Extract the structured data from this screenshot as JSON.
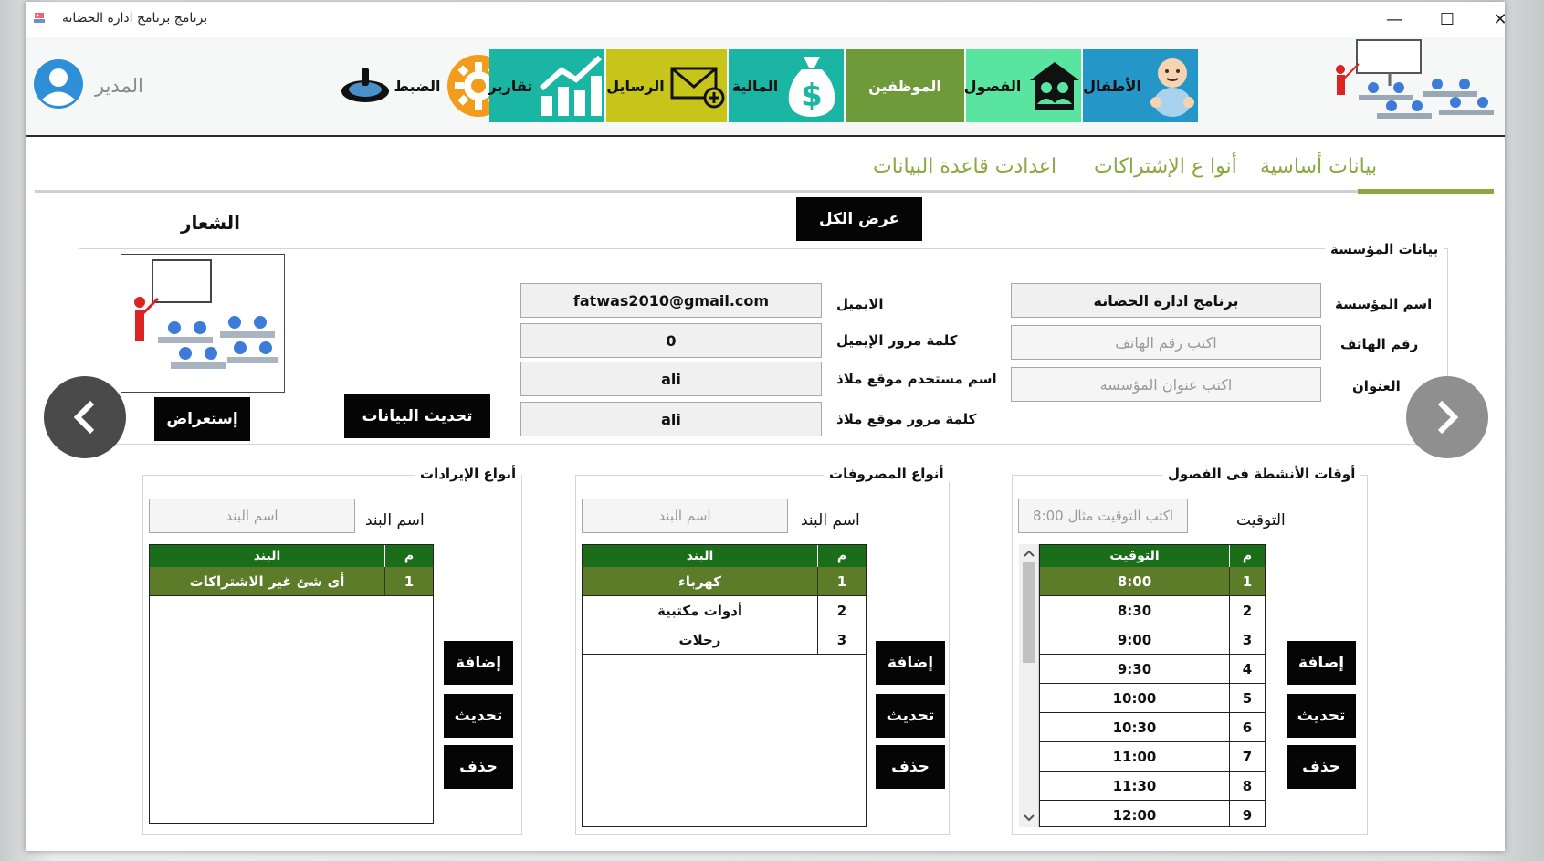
{
  "window": {
    "title": "برنامج  برنامج ادارة الحضانة",
    "controls": {
      "minimize": "—",
      "maximize": "☐",
      "close": "✕"
    }
  },
  "toolbar": {
    "user": "المدير",
    "settings": "الضبط",
    "reports": "تقارير",
    "messages": "الرسايل",
    "finance": "المالية",
    "employees": "الموظفين",
    "classes": "الفصول",
    "children": "الأطفال",
    "colors": {
      "settings": "#f39c1c",
      "reports": "#1ab5a3",
      "messages": "#c8c51a",
      "finance": "#1ab5a3",
      "employees": "#6f9a3a",
      "classes": "#59e59f",
      "children": "#2596c8"
    }
  },
  "tabs": {
    "basic_data": "بيانات أساسية",
    "subscription_types": "أنوا ع الإشتراكات",
    "db_settings": "اعدادت قاعدة البيانات"
  },
  "main": {
    "show_all": "عرض الكل",
    "logo_title": "الشعار",
    "browse": "إستعراض",
    "update_data": "تحديث البيانات"
  },
  "institution": {
    "group_title": "بيانات المؤسسة",
    "name_label": "اسم المؤسسة",
    "name_value": "برنامج ادارة الحضانة",
    "phone_label": "رقم الهاتف",
    "phone_placeholder": "اكتب رقم الهاتف",
    "address_label": "العنوان",
    "address_placeholder": "اكتب عنوان المؤسسة",
    "email_label": "الايميل",
    "email_value": "fatwas2010@gmail.com",
    "email_pass_label": "كلمة مرور الإيميل",
    "email_pass_value": "0",
    "malath_user_label": "اسم مستخدم موقع ملاذ",
    "malath_user_value": "ali",
    "malath_pass_label": "كلمة مرور موقع ملاذ",
    "malath_pass_value": "ali"
  },
  "activity_times": {
    "group_title": "أوقات الأنشطة فى الفصول",
    "time_label": "التوقيت",
    "time_placeholder": "اكتب التوقيت مثال 8:00",
    "col_num": "م",
    "col_time": "التوقيت",
    "rows": [
      {
        "num": "1",
        "value": "8:00"
      },
      {
        "num": "2",
        "value": "8:30"
      },
      {
        "num": "3",
        "value": "9:00"
      },
      {
        "num": "4",
        "value": "9:30"
      },
      {
        "num": "5",
        "value": "10:00"
      },
      {
        "num": "6",
        "value": "10:30"
      },
      {
        "num": "7",
        "value": "11:00"
      },
      {
        "num": "8",
        "value": "11:30"
      },
      {
        "num": "9",
        "value": "12:00"
      }
    ],
    "add": "إضافة",
    "update": "تحديث",
    "delete": "حذف"
  },
  "expenses": {
    "group_title": "أنواع المصروفات",
    "item_label": "اسم البند",
    "item_placeholder": "اسم البند",
    "col_num": "م",
    "col_item": "البند",
    "rows": [
      {
        "num": "1",
        "value": "كهرباء"
      },
      {
        "num": "2",
        "value": "أدوات مكتبية"
      },
      {
        "num": "3",
        "value": "رحلات"
      }
    ],
    "add": "إضافة",
    "update": "تحديث",
    "delete": "حذف"
  },
  "revenues": {
    "group_title": "أنواع الإيرادات",
    "item_label": "اسم البند",
    "item_placeholder": "اسم البند",
    "col_num": "م",
    "col_item": "البند",
    "rows": [
      {
        "num": "1",
        "value": "أى شئ غير الاشتراكات"
      }
    ],
    "add": "إضافة",
    "update": "تحديث",
    "delete": "حذف"
  }
}
